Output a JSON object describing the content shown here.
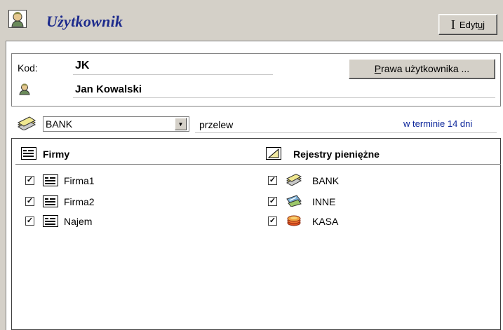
{
  "header": {
    "title": "Użytkownik",
    "edit_label": "Edytuj",
    "icon": "user-icon"
  },
  "user": {
    "kod_label": "Kod:",
    "kod_value": "JK",
    "name": "Jan Kowalski",
    "rights_button_label": "Prawa użytkownika ..."
  },
  "payment": {
    "register": "BANK",
    "method": "przelew",
    "term": "w terminie 14 dni"
  },
  "lists": {
    "companies": {
      "header": "Firmy",
      "items": [
        {
          "label": "Firma1",
          "checked": true
        },
        {
          "label": "Firma2",
          "checked": true
        },
        {
          "label": "Najem",
          "checked": true
        }
      ]
    },
    "registers": {
      "header": "Rejestry pieniężne",
      "items": [
        {
          "label": "BANK",
          "checked": true,
          "icon": "bank-icon"
        },
        {
          "label": "INNE",
          "checked": true,
          "icon": "card-icon"
        },
        {
          "label": "KASA",
          "checked": true,
          "icon": "coins-icon"
        }
      ]
    }
  },
  "colors": {
    "title": "#1c2a8c",
    "term_link": "#0a249a",
    "face": "#d4d0c8"
  }
}
